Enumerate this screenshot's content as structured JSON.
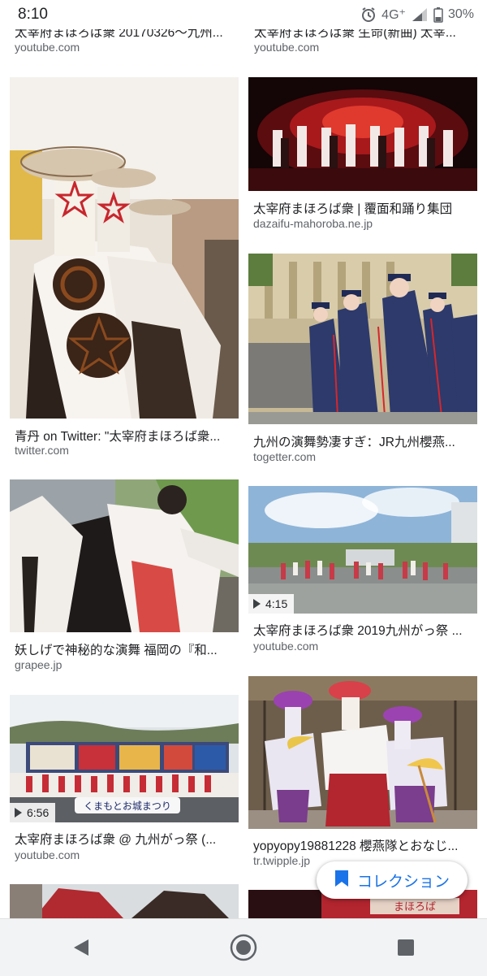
{
  "status": {
    "time": "8:10",
    "network": "4G⁺",
    "battery": "30%"
  },
  "top_row": [
    {
      "title": "太宰府まほろば衆 20170326〜九州...",
      "source": "youtube.com"
    },
    {
      "title": "太宰府まほろば衆 生命(新曲) 太宰...",
      "source": "youtube.com"
    }
  ],
  "results": [
    {
      "title": "青丹 on Twitter: \"太宰府まほろば衆...",
      "source": "twitter.com"
    },
    {
      "title": "太宰府まほろば衆 | 覆面和踊り集団",
      "source": "dazaifu-mahoroba.ne.jp"
    },
    {
      "title": "九州の演舞勢凄すぎ：JR九州櫻燕...",
      "source": "togetter.com"
    },
    {
      "title": "妖しげで神秘的な演舞 福岡の『和...",
      "source": "grapee.jp"
    },
    {
      "title": "太宰府まほろば衆 2019九州がっ祭 ...",
      "source": "youtube.com",
      "duration": "4:15"
    },
    {
      "title": "太宰府まほろば衆 @ 九州がっ祭 (...",
      "source": "youtube.com",
      "duration": "6:56"
    },
    {
      "title": "yopyopy19881228 櫻燕隊とおなじ...",
      "source": "tr.twipple.jp"
    }
  ],
  "thumbnail_captions": {
    "banner": "くまもとお城まつり",
    "sign": "まほろば"
  },
  "collection": {
    "label": "コレクション",
    "icon": "bookmark-icon"
  },
  "nav": {
    "back": "back-icon",
    "home": "home-icon",
    "recents": "recents-icon"
  },
  "colors": {
    "accent": "#1a73e8",
    "title": "#202124",
    "source": "#5f6368"
  }
}
